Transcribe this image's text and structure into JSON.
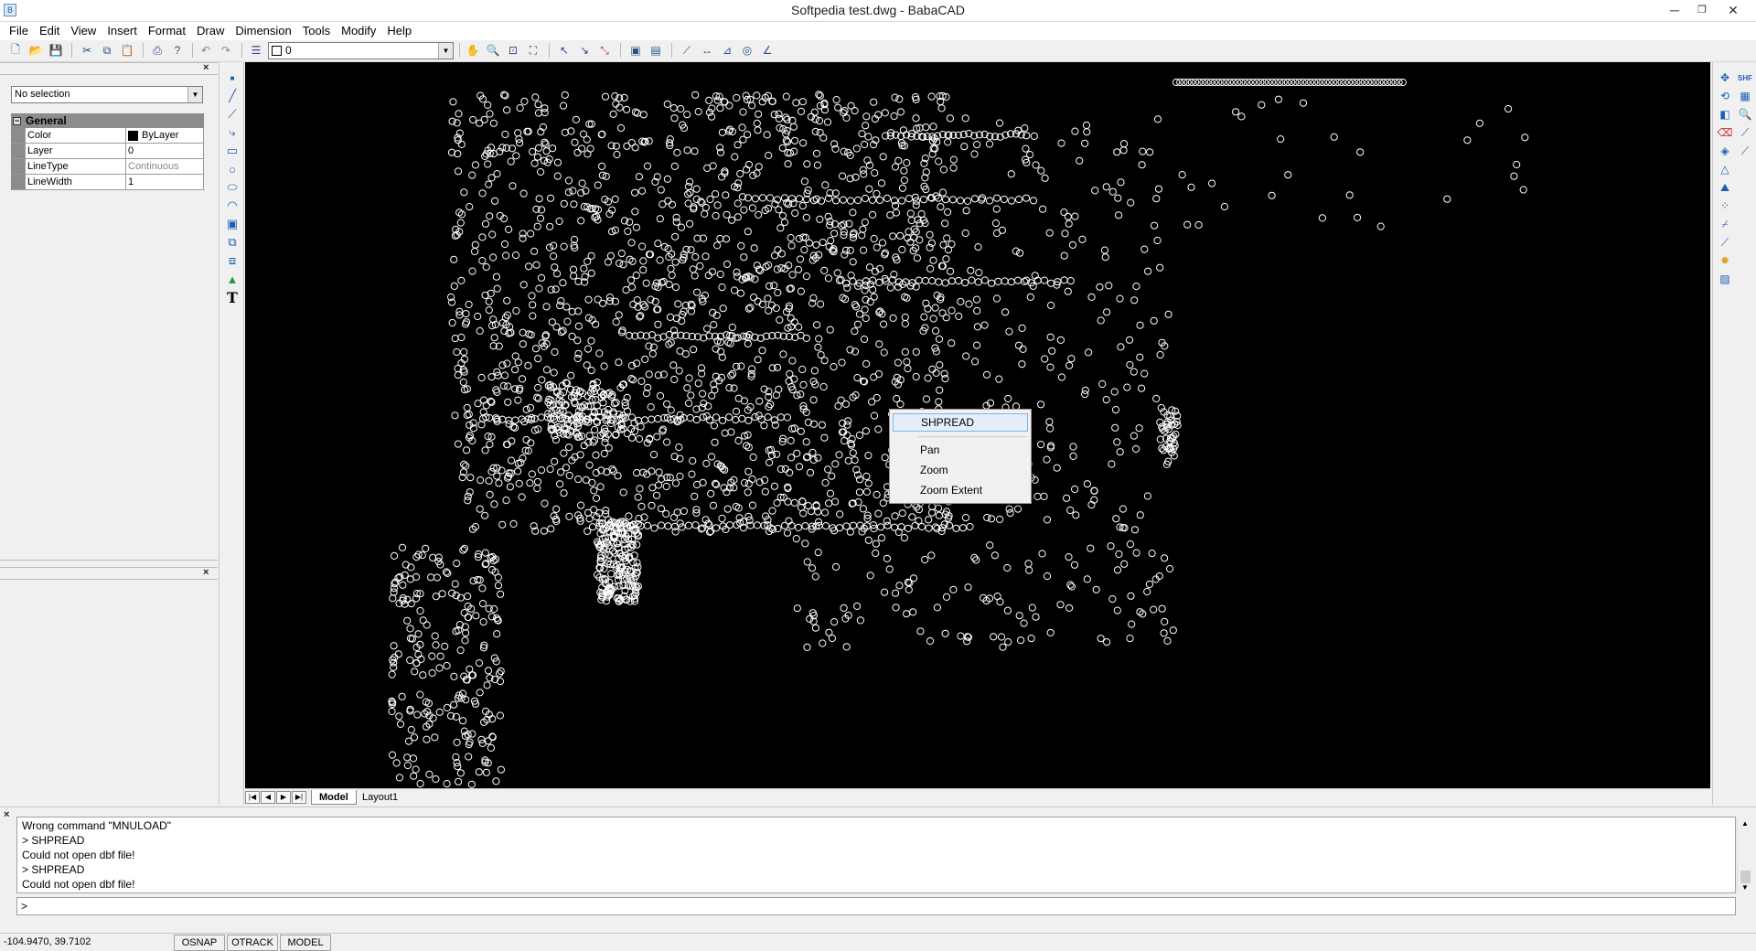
{
  "window": {
    "title": "Softpedia test.dwg - BabaCAD",
    "app_icon": "babacad-icon",
    "controls": [
      "minimize-icon",
      "restore-icon",
      "close-icon"
    ]
  },
  "menu": [
    "File",
    "Edit",
    "View",
    "Insert",
    "Format",
    "Draw",
    "Dimension",
    "Tools",
    "Modify",
    "Help"
  ],
  "toolbar": {
    "layer_value": "0",
    "icons": [
      "new-icon",
      "open-icon",
      "save-icon",
      "cut-icon",
      "copy-icon",
      "paste-icon",
      "print-icon",
      "help-icon",
      "undo-icon",
      "redo-icon",
      "layers-icon",
      "pan-icon",
      "zoom-realtime-icon",
      "zoom-window-icon",
      "zoom-extents-icon",
      "snap-icon",
      "snap-endpoint-icon",
      "snap-midpoint-icon",
      "view-icon",
      "view2-icon",
      "dim-icon",
      "dim-linear-icon",
      "dim-aligned-icon",
      "dim-radius-icon",
      "dim-angle-icon"
    ]
  },
  "properties_panel": {
    "selection": "No selection",
    "group": "General",
    "rows": [
      {
        "key": "Color",
        "value": "ByLayer",
        "swatch": "#000000"
      },
      {
        "key": "Layer",
        "value": "0"
      },
      {
        "key": "LineType",
        "value": "Continuous"
      },
      {
        "key": "LineWidth",
        "value": "1"
      }
    ]
  },
  "draw_tools": [
    "point-icon",
    "line-icon",
    "polyline-icon",
    "arc-icon",
    "rectangle-icon",
    "circle-icon",
    "ellipse-icon",
    "arc2-icon",
    "block-icon",
    "region-icon",
    "hatch-icon",
    "image-icon",
    "text-icon"
  ],
  "modify_tools": [
    "move-icon",
    "snapshot-icon",
    "copy-icon",
    "grid-icon",
    "rotate-icon",
    "zoom-icon",
    "mirror-icon",
    "erase-icon",
    "offset-icon",
    "trim-icon",
    "fillet-icon",
    "array-icon",
    "explode-icon",
    "break-icon",
    "stretch-icon",
    "extend-icon",
    "light-icon",
    "hatch-icon"
  ],
  "tabs": {
    "items": [
      "Model",
      "Layout1"
    ],
    "active": "Model"
  },
  "context_menu": {
    "items": [
      "SHPREAD",
      "Pan",
      "Zoom",
      "Zoom Extent"
    ],
    "highlighted": "SHPREAD"
  },
  "command_history": [
    "Wrong command \"MNULOAD\"",
    "> SHPREAD",
    "Could not open dbf file!",
    "> SHPREAD",
    "Could not open dbf file!"
  ],
  "command_prompt": ">",
  "status": {
    "coords": "-104.9470, 39.7102",
    "buttons": [
      "OSNAP",
      "OTRACK",
      "MODEL"
    ]
  },
  "colors": {
    "canvas_bg": "#000000",
    "drawing_stroke": "#ffffff",
    "menu_highlight": "#e5effb"
  }
}
